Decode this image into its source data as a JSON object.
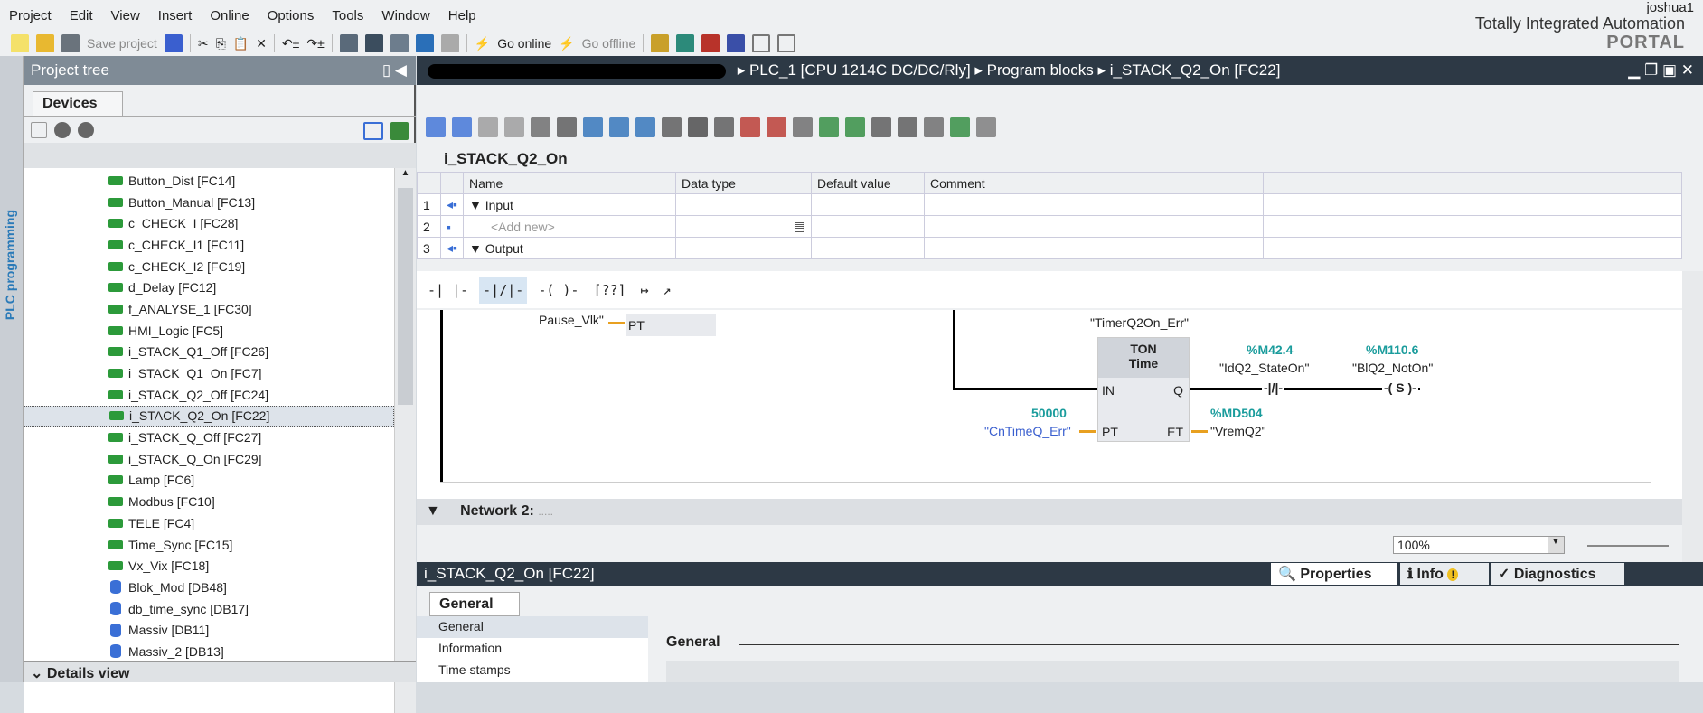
{
  "menu": [
    "Project",
    "Edit",
    "View",
    "Insert",
    "Online",
    "Options",
    "Tools",
    "Window",
    "Help"
  ],
  "toolbar": {
    "save_project": "Save project",
    "go_online": "Go online",
    "go_offline": "Go offline"
  },
  "brand": {
    "line1": "Totally Integrated Automation",
    "line2": "PORTAL",
    "user": "joshua1"
  },
  "side_strip": "PLC programming",
  "project_tree": {
    "title": "Project tree",
    "tab": "Devices",
    "details_view": "Details view",
    "items": [
      {
        "label": "Button_Dist [FC14]",
        "type": "fc"
      },
      {
        "label": "Button_Manual [FC13]",
        "type": "fc"
      },
      {
        "label": "c_CHECK_I [FC28]",
        "type": "fc"
      },
      {
        "label": "c_CHECK_I1 [FC11]",
        "type": "fc"
      },
      {
        "label": "c_CHECK_I2 [FC19]",
        "type": "fc"
      },
      {
        "label": "d_Delay [FC12]",
        "type": "fc"
      },
      {
        "label": "f_ANALYSE_1 [FC30]",
        "type": "fc"
      },
      {
        "label": "HMI_Logic [FC5]",
        "type": "fc"
      },
      {
        "label": "i_STACK_Q1_Off [FC26]",
        "type": "fc"
      },
      {
        "label": "i_STACK_Q1_On [FC7]",
        "type": "fc"
      },
      {
        "label": "i_STACK_Q2_Off [FC24]",
        "type": "fc"
      },
      {
        "label": "i_STACK_Q2_On [FC22]",
        "type": "fc",
        "selected": true
      },
      {
        "label": "i_STACK_Q_Off [FC27]",
        "type": "fc"
      },
      {
        "label": "i_STACK_Q_On [FC29]",
        "type": "fc"
      },
      {
        "label": "Lamp [FC6]",
        "type": "fc"
      },
      {
        "label": "Modbus [FC10]",
        "type": "fc"
      },
      {
        "label": "TELE [FC4]",
        "type": "fc"
      },
      {
        "label": "Time_Sync [FC15]",
        "type": "fc"
      },
      {
        "label": "Vx_Vix [FC18]",
        "type": "fc"
      },
      {
        "label": "Blok_Mod [DB48]",
        "type": "db"
      },
      {
        "label": "db_time_sync [DB17]",
        "type": "db"
      },
      {
        "label": "Massiv [DB11]",
        "type": "db"
      },
      {
        "label": "Massiv_2 [DB13]",
        "type": "db"
      }
    ]
  },
  "editor": {
    "breadcrumb": [
      "PLC_1 [CPU 1214C DC/DC/Rly]",
      "Program blocks",
      "i_STACK_Q2_On [FC22]"
    ],
    "block_name": "i_STACK_Q2_On",
    "interface": {
      "headers": [
        "Name",
        "Data type",
        "Default value",
        "Comment"
      ],
      "rows": [
        {
          "num": "1",
          "name": "Input"
        },
        {
          "num": "2",
          "name": "<Add new>"
        },
        {
          "num": "3",
          "name": "Output"
        }
      ]
    },
    "lad_tools": [
      "-| |-",
      "-|/|-",
      "-( )-",
      "[??]",
      "↦",
      "↗"
    ],
    "network1": {
      "prev_param": "Pause_Vlk\"",
      "prev_pin": "PT",
      "timer_instance": "\"TimerQ2On_Err\"",
      "timer_type": "TON",
      "timer_subtype": "Time",
      "pin_in": "IN",
      "pin_q": "Q",
      "pin_pt": "PT",
      "pin_et": "ET",
      "pt_value": "50000",
      "pt_tag": "\"CnTimeQ_Err\"",
      "et_addr": "%MD504",
      "et_tag": "\"VremQ2\"",
      "contact_addr": "%M42.4",
      "contact_tag": "\"IdQ2_StateOn\"",
      "coil_addr": "%M110.6",
      "coil_tag": "\"BlQ2_NotOn\"",
      "coil_type": "S"
    },
    "network2": {
      "title": "Network 2:",
      "comment": "....."
    },
    "zoom": "100%"
  },
  "inspector": {
    "title": "i_STACK_Q2_On [FC22]",
    "tabs": [
      "Properties",
      "Info",
      "Diagnostics"
    ],
    "general_tab": "General",
    "list": [
      "General",
      "Information",
      "Time stamps"
    ],
    "section": "General"
  }
}
